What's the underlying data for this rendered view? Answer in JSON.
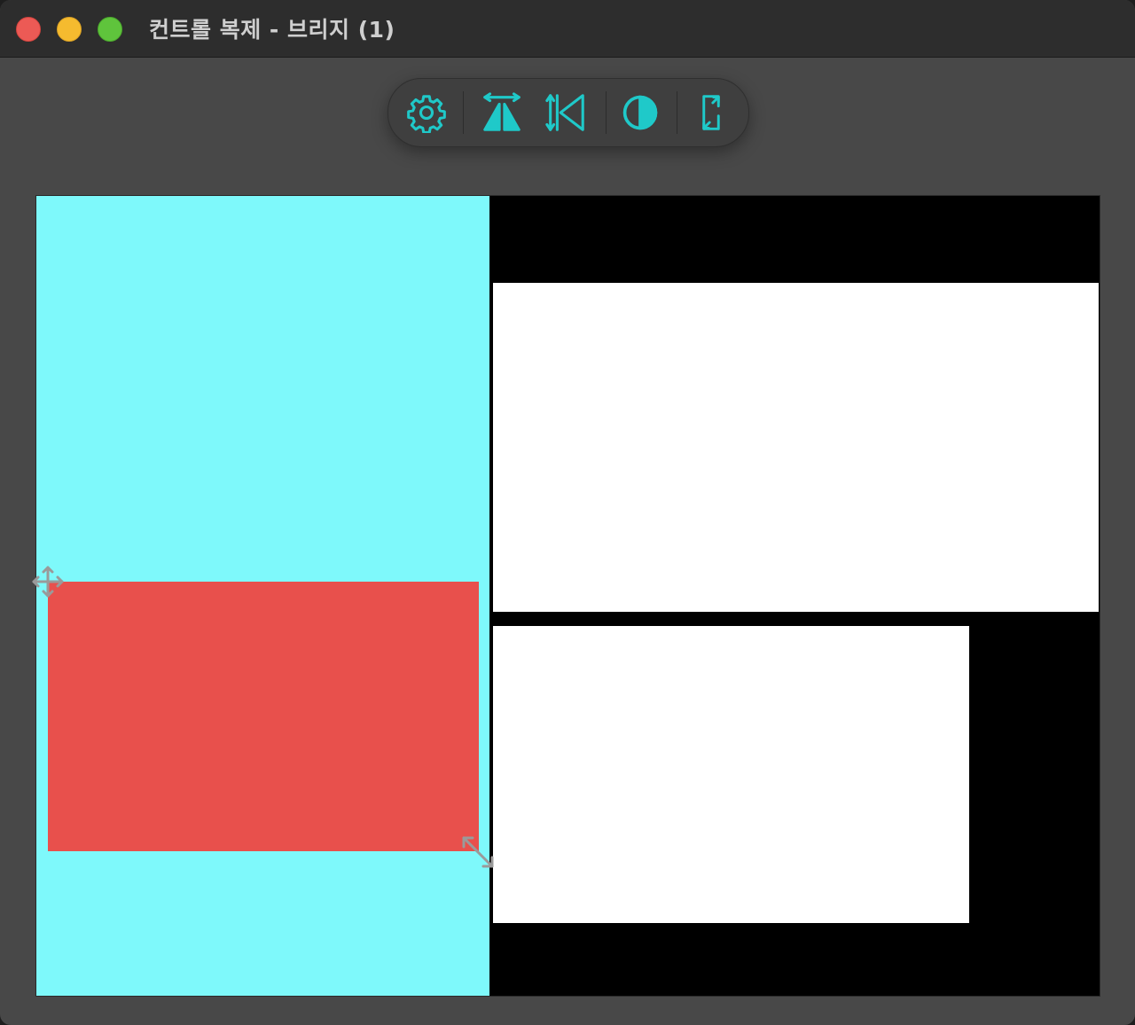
{
  "window": {
    "title": "컨트롤 복제 - 브리지 (1)"
  },
  "traffic_lights": {
    "close": "close",
    "minimize": "minimize",
    "maximize": "maximize"
  },
  "toolbar": {
    "buttons": [
      {
        "icon": "gear-icon"
      },
      {
        "icon": "flip-horizontal-icon"
      },
      {
        "icon": "flip-vertical-icon"
      },
      {
        "icon": "contrast-icon"
      },
      {
        "icon": "rotate-screen-icon"
      }
    ],
    "accent_color": "#1fc9c9"
  },
  "canvas": {
    "colors": {
      "background": "#000000",
      "panel": "#7ef9fb",
      "selected_shape": "#e8504c",
      "rectangles": "#ffffff"
    }
  }
}
